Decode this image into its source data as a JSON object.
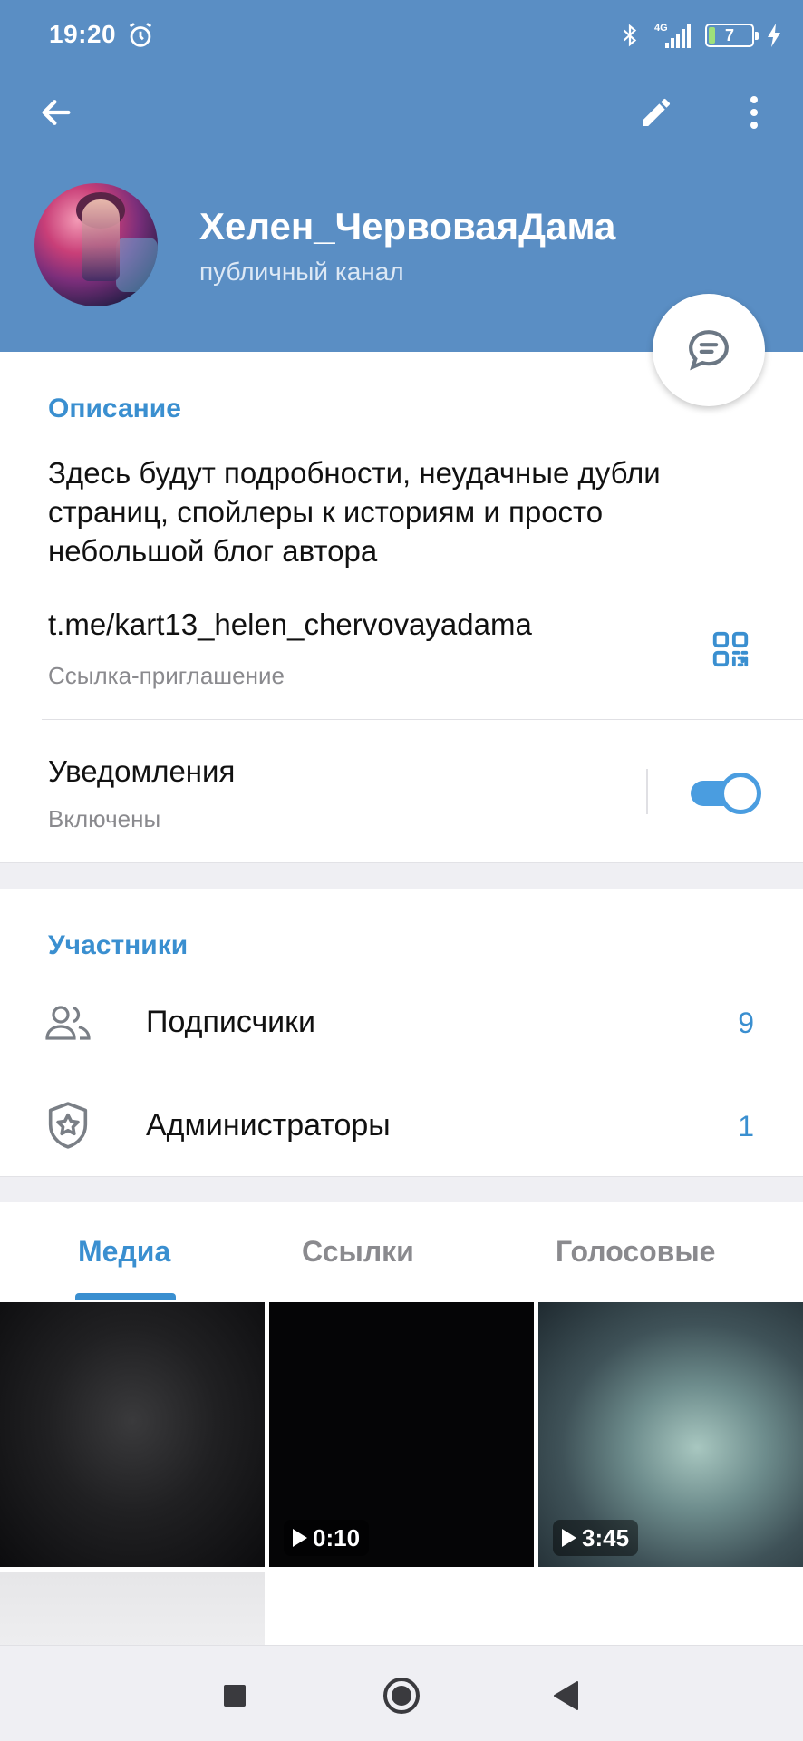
{
  "status_bar": {
    "time": "19:20",
    "network": "4G",
    "battery_level": "7"
  },
  "toolbar": {
    "back_icon": "arrow-left-icon",
    "edit_icon": "pencil-icon",
    "more_icon": "more-vertical-icon"
  },
  "channel": {
    "title": "Хелен_ЧервоваяДама",
    "subtitle": "публичный канал"
  },
  "discussion_icon": "chat-bubble-icon",
  "info": {
    "section_title": "Описание",
    "description": "Здесь будут подробности, неудачные дубли страниц, спойлеры к историям и просто небольшой блог автора",
    "link": "t.me/kart13_helen_chervovayadama",
    "link_caption": "Ссылка-приглашение",
    "notifications_label": "Уведомления",
    "notifications_status": "Включены",
    "notifications_enabled": true
  },
  "participants": {
    "section_title": "Участники",
    "rows": [
      {
        "label": "Подписчики",
        "count": "9",
        "icon": "users-icon"
      },
      {
        "label": "Администраторы",
        "count": "1",
        "icon": "shield-star-icon"
      }
    ]
  },
  "media_tabs": {
    "tabs": [
      {
        "label": "Медиа",
        "active": true
      },
      {
        "label": "Ссылки",
        "active": false
      },
      {
        "label": "Голосовые",
        "active": false
      }
    ],
    "tiles": [
      {
        "type": "photo"
      },
      {
        "type": "video",
        "duration": "0:10"
      },
      {
        "type": "video",
        "duration": "3:45"
      },
      {
        "type": "photo"
      }
    ]
  },
  "colors": {
    "header": "#5a8ec4",
    "accent": "#3a8fd0",
    "toggle": "#4a9de0"
  },
  "nav_bar": {
    "buttons": [
      "recents-square-icon",
      "home-circle-icon",
      "back-triangle-icon"
    ]
  }
}
